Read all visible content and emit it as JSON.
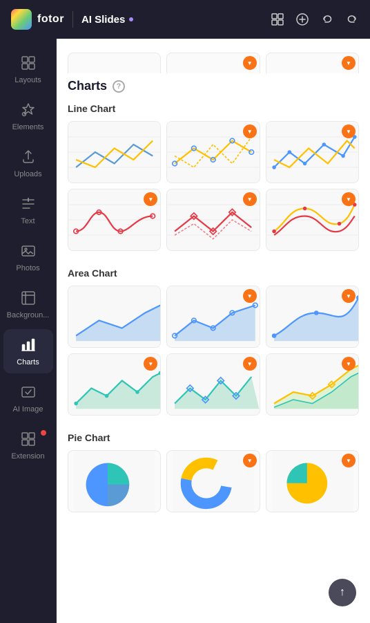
{
  "app": {
    "logo_text": "fotor",
    "title": "AI Slides",
    "title_dot_color": "#a78bfa"
  },
  "topbar": {
    "grid_icon": "grid-icon",
    "add_icon": "add-icon",
    "undo_icon": "undo-icon",
    "redo_icon": "redo-icon"
  },
  "nav": {
    "items": [
      {
        "id": "layouts",
        "label": "Layouts",
        "active": false
      },
      {
        "id": "elements",
        "label": "Elements",
        "active": false
      },
      {
        "id": "uploads",
        "label": "Uploads",
        "active": false
      },
      {
        "id": "text",
        "label": "Text",
        "active": false
      },
      {
        "id": "photos",
        "label": "Photos",
        "active": false
      },
      {
        "id": "backgrounds",
        "label": "Backgroun...",
        "active": false
      },
      {
        "id": "charts",
        "label": "Charts",
        "active": true
      },
      {
        "id": "ai-image",
        "label": "AI Image",
        "active": false
      },
      {
        "id": "extension",
        "label": "Extension",
        "active": false
      }
    ]
  },
  "content": {
    "page_title": "Charts",
    "help_label": "?",
    "sections": [
      {
        "id": "line-chart",
        "title": "Line Chart",
        "rows": [
          {
            "cards": [
              {
                "id": "lc1",
                "favorited": false,
                "type": "line-blue-yellow"
              },
              {
                "id": "lc2",
                "favorited": true,
                "type": "line-yellow-circle"
              },
              {
                "id": "lc3",
                "favorited": true,
                "type": "line-blue-yellow2"
              }
            ]
          },
          {
            "cards": [
              {
                "id": "lc4",
                "favorited": true,
                "type": "line-red-curve"
              },
              {
                "id": "lc5",
                "favorited": true,
                "type": "line-red-diamond"
              },
              {
                "id": "lc6",
                "favorited": true,
                "type": "line-red-dot"
              }
            ]
          }
        ]
      },
      {
        "id": "area-chart",
        "title": "Area Chart",
        "rows": [
          {
            "cards": [
              {
                "id": "ac1",
                "favorited": false,
                "type": "area-blue1"
              },
              {
                "id": "ac2",
                "favorited": true,
                "type": "area-blue-circle"
              },
              {
                "id": "ac3",
                "favorited": true,
                "type": "area-blue-curve"
              }
            ]
          },
          {
            "cards": [
              {
                "id": "ac4",
                "favorited": true,
                "type": "area-green1"
              },
              {
                "id": "ac5",
                "favorited": true,
                "type": "area-green-diamond"
              },
              {
                "id": "ac6",
                "favorited": true,
                "type": "area-yellow-green"
              }
            ]
          }
        ]
      },
      {
        "id": "pie-chart",
        "title": "Pie Chart",
        "rows": [
          {
            "cards": [
              {
                "id": "pc1",
                "favorited": false,
                "type": "pie-blue"
              },
              {
                "id": "pc2",
                "favorited": true,
                "type": "pie-yellow-blue"
              },
              {
                "id": "pc3",
                "favorited": true,
                "type": "pie-yellow-teal"
              }
            ]
          }
        ]
      }
    ],
    "back_to_top_label": "↑"
  }
}
